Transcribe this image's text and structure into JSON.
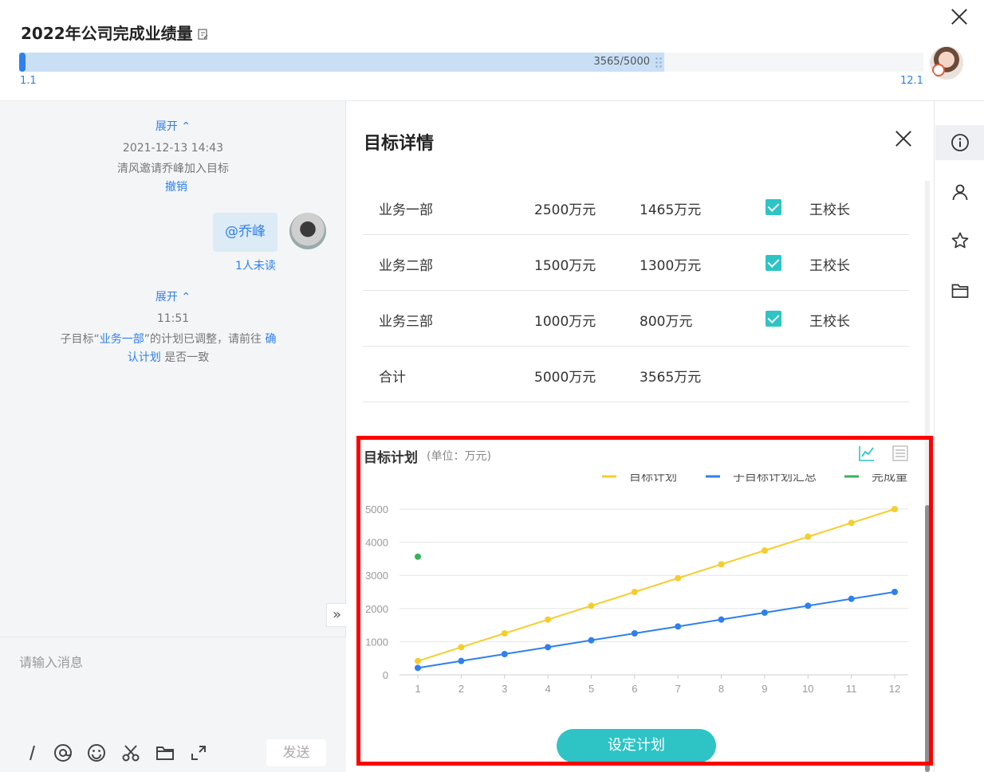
{
  "header": {
    "title": "2022年公司完成业绩量",
    "progress_text": "3565/5000",
    "progress_value": 3565,
    "progress_max": 5000,
    "start_label": "1.1",
    "end_label": "12.1"
  },
  "chat": {
    "expand1": "展开 ⌃",
    "time1": "2021-12-13 14:43",
    "event1": "清风邀请乔峰加入目标",
    "revoke": "撤销",
    "bubble": "@乔峰",
    "unread": "1人未读",
    "expand2": "展开 ⌃",
    "time2": "11:51",
    "msg_prefix": "子目标“",
    "msg_link1": "业务一部",
    "msg_mid": "”的计划已调整，请前往",
    "msg_link2a": "确",
    "msg_link2b": "认计划",
    "msg_suffix": "是否一致",
    "collapse": "»",
    "input_placeholder": "请输入消息",
    "send": "发送"
  },
  "detail": {
    "title": "目标详情",
    "rows": [
      {
        "dept": "业务一部",
        "target": "2500万元",
        "done": "1465万元",
        "checked": true,
        "owner": "王校长"
      },
      {
        "dept": "业务二部",
        "target": "1500万元",
        "done": "1300万元",
        "checked": true,
        "owner": "王校长"
      },
      {
        "dept": "业务三部",
        "target": "1000万元",
        "done": "800万元",
        "checked": true,
        "owner": "王校长"
      },
      {
        "dept": "合计",
        "target": "5000万元",
        "done": "3565万元",
        "checked": false,
        "owner": ""
      }
    ],
    "plan_title": "目标计划",
    "plan_unit": "(单位：万元)",
    "set_plan": "设定计划"
  },
  "colors": {
    "target": "#f5cd2d",
    "sub": "#2f80ed",
    "done": "#36b45a",
    "accent": "#2ec4c6"
  },
  "chart_data": {
    "type": "line",
    "x": [
      1,
      2,
      3,
      4,
      5,
      6,
      7,
      8,
      9,
      10,
      11,
      12
    ],
    "ylim": [
      0,
      5000
    ],
    "yticks": [
      0,
      1000,
      2000,
      3000,
      4000,
      5000
    ],
    "legend_position": "top-right",
    "grid": true,
    "series": [
      {
        "name": "目标计划",
        "values": [
          417,
          833,
          1250,
          1667,
          2083,
          2500,
          2917,
          3333,
          3750,
          4167,
          4583,
          5000
        ]
      },
      {
        "name": "子目标计划汇总",
        "values": [
          208,
          417,
          625,
          833,
          1042,
          1250,
          1458,
          1667,
          1875,
          2083,
          2292,
          2500
        ]
      },
      {
        "name": "完成量",
        "values": [
          3565,
          null,
          null,
          null,
          null,
          null,
          null,
          null,
          null,
          null,
          null,
          null
        ]
      }
    ]
  }
}
